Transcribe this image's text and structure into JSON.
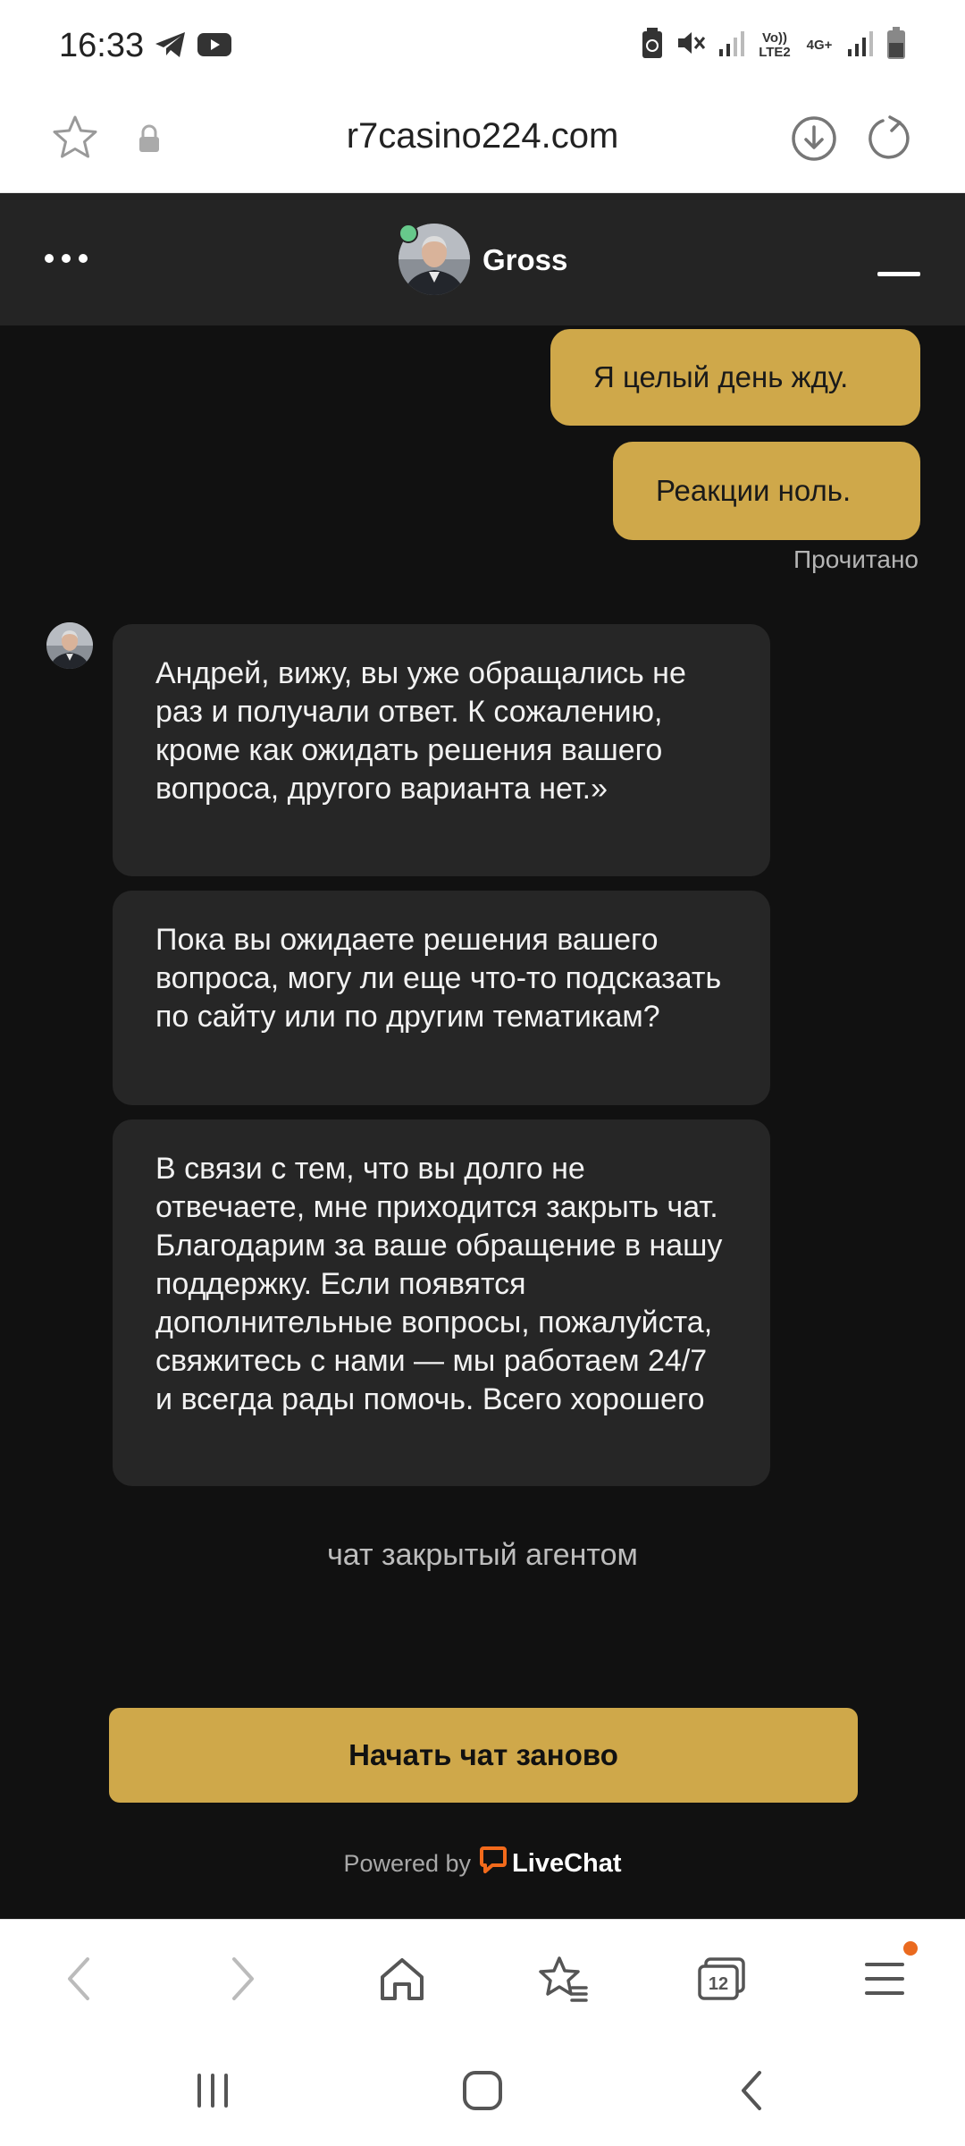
{
  "status_bar": {
    "time": "16:33",
    "network_1": "Vo)) LTE2",
    "network_2": "4G+"
  },
  "browser": {
    "url": "r7casino224.com"
  },
  "chat": {
    "agent_name": "Gross",
    "outgoing": [
      "Я целый день жду.",
      "Реакции ноль."
    ],
    "read_status": "Прочитано",
    "incoming": [
      "Андрей, вижу, вы уже обращались не раз и получали ответ. К сожалению, кроме как ожидать решения вашего вопроса, другого варианта нет.»",
      "Пока вы ожидаете решения вашего вопроса, могу ли еще что-то подсказать по сайту или по другим тематикам?",
      "В связи с тем, что вы долго не отвечаете, мне приходится закрыть чат. Благодарим за ваше обращение в нашу поддержку. Если появятся дополнительные вопросы, пожалуйста, свяжитесь с нами — мы работаем 24/7 и всегда рады помочь. Всего хорошего"
    ],
    "closed_note": "чат закрытый агентом",
    "restart_label": "Начать чат заново",
    "powered_by": "Powered by",
    "brand": "LiveChat"
  },
  "browser_nav": {
    "tabs_count": "12"
  },
  "colors": {
    "accent": "#cfa84a",
    "chat_bg": "#111111",
    "header_bg": "#242424",
    "bubble_in": "#262626",
    "online": "#67c98b",
    "livechat_orange": "#f26a1b"
  }
}
